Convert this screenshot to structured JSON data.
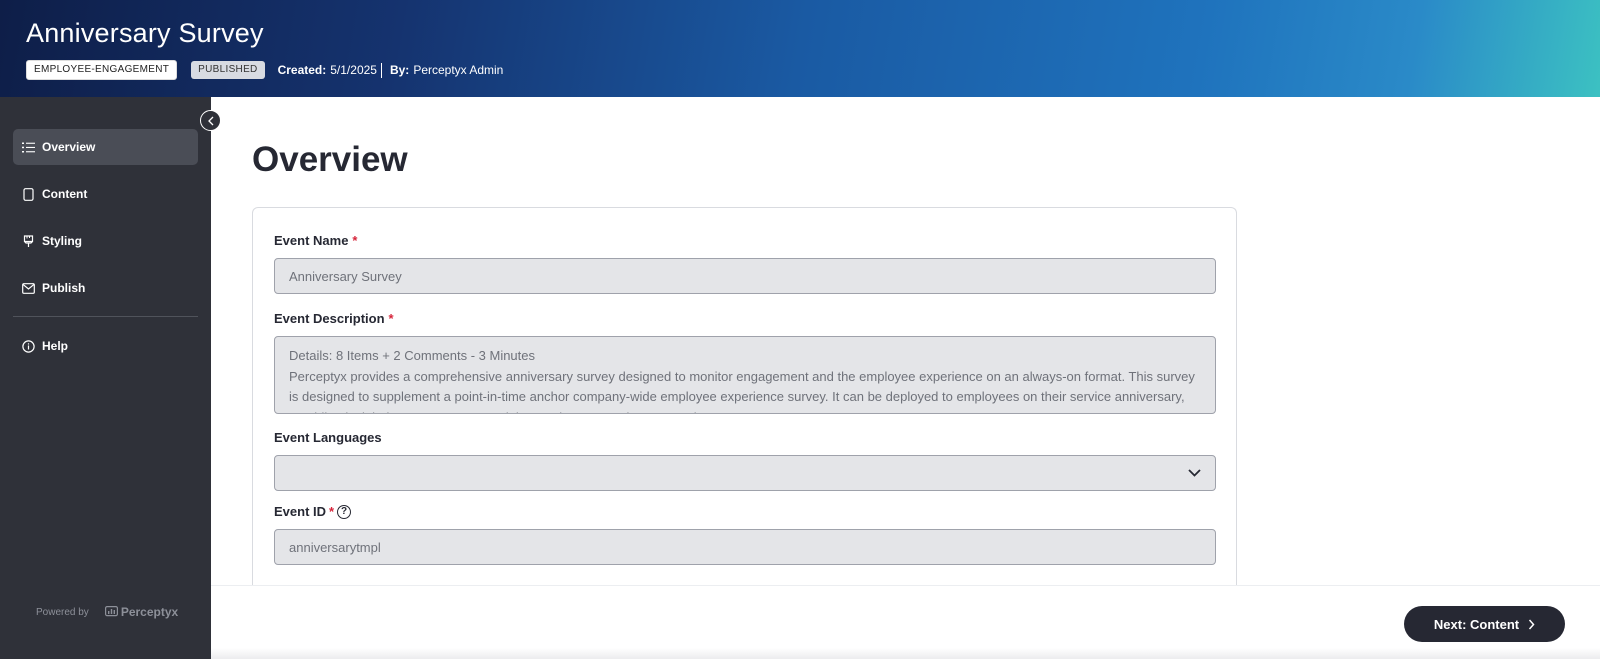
{
  "header": {
    "title": "Anniversary Survey",
    "tag_category": "EMPLOYEE-ENGAGEMENT",
    "tag_status": "PUBLISHED",
    "created_label": "Created:",
    "created_value": "5/1/2025",
    "by_label": "By:",
    "by_value": "Perceptyx Admin"
  },
  "sidebar": {
    "items": [
      {
        "label": "Overview",
        "icon": "list-icon",
        "active": true
      },
      {
        "label": "Content",
        "icon": "document-icon"
      },
      {
        "label": "Styling",
        "icon": "paint-brush-icon"
      },
      {
        "label": "Publish",
        "icon": "envelope-icon"
      },
      {
        "label": "Help",
        "icon": "info-icon"
      }
    ],
    "powered_by": "Powered by",
    "brand": "Perceptyx"
  },
  "main": {
    "title": "Overview",
    "fields": {
      "event_name": {
        "label": "Event Name",
        "required": "*",
        "value": "Anniversary Survey"
      },
      "event_description": {
        "label": "Event Description",
        "required": "*",
        "value": "Details: 8 Items + 2 Comments - 3 Minutes\nPerceptyx provides a comprehensive anniversary survey designed to monitor engagement and the employee experience on an always-on format. This survey is designed to supplement a point-in-time anchor company-wide employee experience survey. It can be deployed to employees on their service anniversary, providing insight into engagement and the employee experience over time."
      },
      "event_languages": {
        "label": "Event Languages",
        "value": ""
      },
      "event_id": {
        "label": "Event ID",
        "required": "*",
        "value": "anniversarytmpl"
      }
    }
  },
  "footer": {
    "next_label": "Next: Content"
  },
  "colors": {
    "sidebar_bg": "#2f3139",
    "button_bg": "#262833",
    "required": "#d6243a"
  }
}
